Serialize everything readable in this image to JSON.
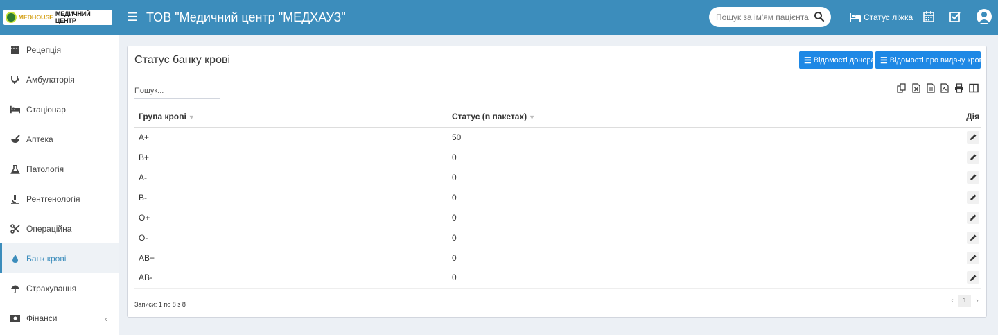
{
  "header": {
    "logo_brand": "MEDHOUSE",
    "logo_sub": "МЕДИЧНИЙ ЦЕНТР",
    "title": "ТОВ \"Медичний центр \"МЕДХАУЗ\"",
    "search_placeholder": "Пошук за ім'ям пацієнта",
    "bed_status_label": "Статус ліжка"
  },
  "sidebar": {
    "items": [
      {
        "label": "Рецепція",
        "icon": "reception-icon"
      },
      {
        "label": "Амбулаторія",
        "icon": "stethoscope-icon"
      },
      {
        "label": "Стаціонар",
        "icon": "bed-icon"
      },
      {
        "label": "Аптека",
        "icon": "mortar-pestle-icon"
      },
      {
        "label": "Патологія",
        "icon": "flask-icon"
      },
      {
        "label": "Рентгенологія",
        "icon": "xray-icon"
      },
      {
        "label": "Операційна",
        "icon": "scissors-icon"
      },
      {
        "label": "Банк крові",
        "icon": "blood-drop-icon"
      },
      {
        "label": "Страхування",
        "icon": "umbrella-icon"
      },
      {
        "label": "Фінанси",
        "icon": "money-icon"
      }
    ],
    "active_index": 7
  },
  "panel": {
    "title": "Статус банку крові",
    "donor_button": "Відомості донора",
    "issue_button": "Відомості про видачу крові",
    "table_search_placeholder": "Пошук...",
    "columns": [
      "Група крові",
      "Статус (в пакетах)",
      "Дія"
    ],
    "rows": [
      {
        "group": "A+",
        "status": "50"
      },
      {
        "group": "B+",
        "status": "0"
      },
      {
        "group": "A-",
        "status": "0"
      },
      {
        "group": "B-",
        "status": "0"
      },
      {
        "group": "O+",
        "status": "0"
      },
      {
        "group": "O-",
        "status": "0"
      },
      {
        "group": "AB+",
        "status": "0"
      },
      {
        "group": "AB-",
        "status": "0"
      }
    ],
    "records_info": "Записи: 1 по 8 з 8",
    "pagination": {
      "prev": "‹",
      "current": "1",
      "next": "›"
    }
  },
  "colors": {
    "header_bg": "#3c8dbc",
    "accent": "#1e88e5",
    "body_bg": "#ecf0f5"
  }
}
